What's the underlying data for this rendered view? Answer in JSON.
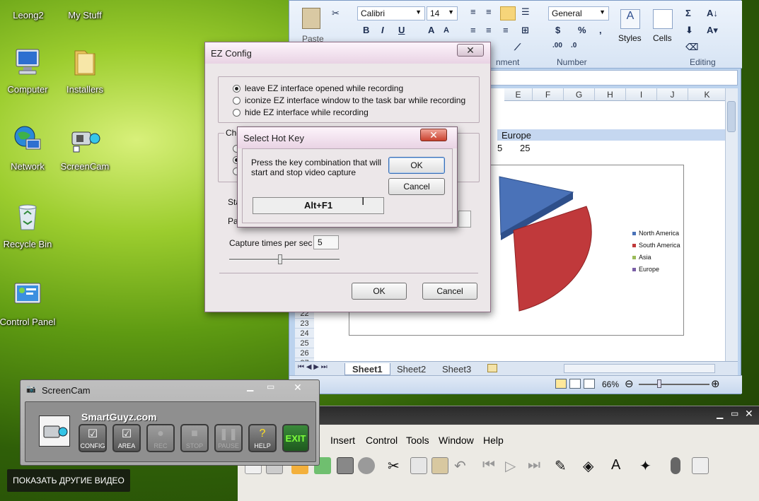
{
  "desktop": {
    "icons": [
      {
        "label": "Leong2"
      },
      {
        "label": "My Stuff"
      },
      {
        "label": "Computer"
      },
      {
        "label": "Installers"
      },
      {
        "label": "Network"
      },
      {
        "label": "ScreenCam"
      },
      {
        "label": "Recycle Bin"
      },
      {
        "label": "Control Panel"
      }
    ]
  },
  "excel": {
    "paste_label": "Paste",
    "font_name": "Calibri",
    "font_size": "14",
    "number_format": "General",
    "styles_label": "Styles",
    "cells_label": "Cells",
    "group_alignment": "nment",
    "group_number": "Number",
    "group_editing": "Editing",
    "columns": [
      "E",
      "F",
      "G",
      "H",
      "I",
      "J",
      "K"
    ],
    "rows": [
      "22",
      "23",
      "24",
      "25",
      "26",
      "27"
    ],
    "cell_europe": "Europe",
    "cell_5": "5",
    "cell_25": "25",
    "sheet_tabs": [
      "Sheet1",
      "Sheet2",
      "Sheet3"
    ],
    "zoom": "66%",
    "chart": {
      "legend": [
        "North America",
        "South America",
        "Asia",
        "Europe"
      ],
      "colors": [
        "#4a72b8",
        "#c0393b",
        "#9bbb59",
        "#7a5fa6"
      ]
    }
  },
  "app2": {
    "menu": [
      "Insert",
      "Control",
      "Tools",
      "Window",
      "Help"
    ]
  },
  "ez_config": {
    "title": "EZ Config",
    "opt1": "leave EZ interface opened while recording",
    "opt2": "iconize EZ interface window to the task bar while recording",
    "opt3": "hide EZ interface while recording",
    "group2_label": "Cho",
    "sta_label": "Sta",
    "pa_label": "Pa",
    "capture_label": "Capture times per sec",
    "capture_value": "5",
    "ok": "OK",
    "cancel": "Cancel"
  },
  "hotkey": {
    "title": "Select Hot Key",
    "prompt": "Press the key combination that will start and stop video capture",
    "value": "Alt+F1",
    "ok": "OK",
    "cancel": "Cancel"
  },
  "screencam": {
    "title": "ScreenCam",
    "brand": "SmartGuyz.com",
    "buttons": [
      "CONFIG",
      "AREA",
      "REC",
      "STOP",
      "PAUSE",
      "HELP",
      "EXIT"
    ]
  },
  "overlay": {
    "show_more": "ПОКАЗАТЬ ДРУГИЕ ВИДЕО"
  }
}
